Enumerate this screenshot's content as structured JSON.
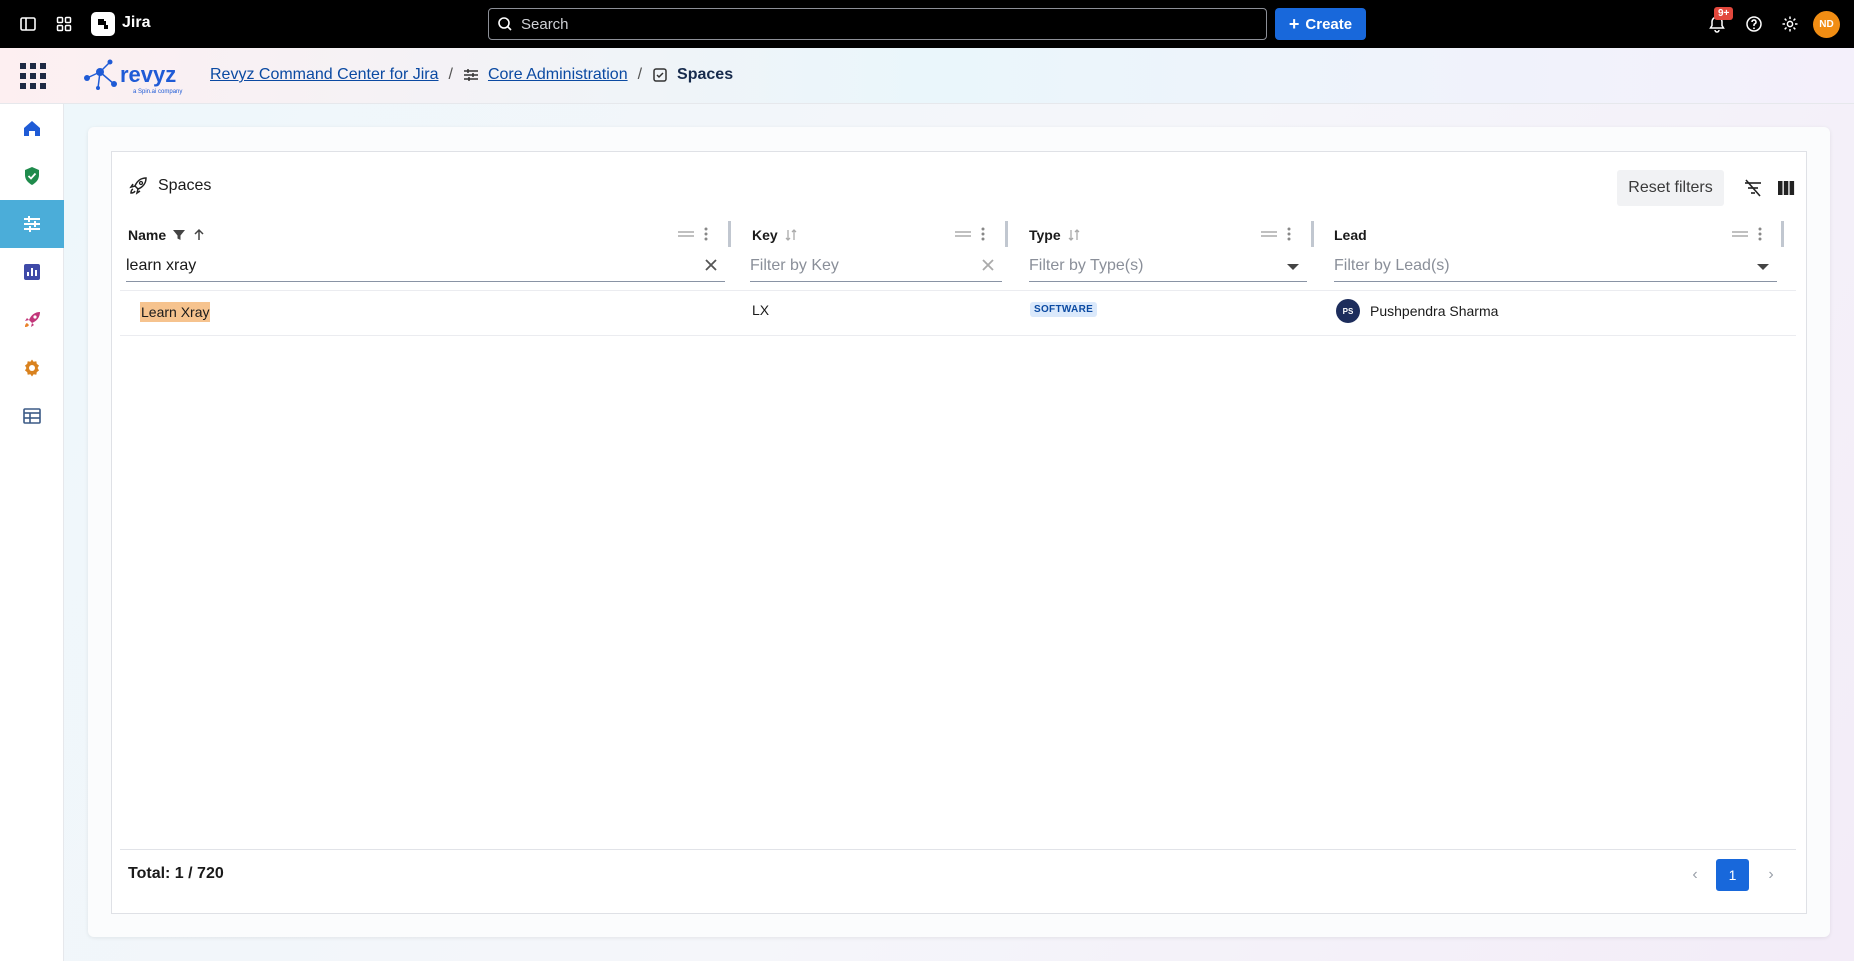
{
  "topbar": {
    "app_name": "Jira",
    "search_placeholder": "Search",
    "create_label": "Create",
    "notification_count": "9+",
    "avatar_initials": "ND"
  },
  "header": {
    "breadcrumbs": [
      {
        "label": "Revyz Command Center for Jira"
      },
      {
        "label": "Core Administration"
      },
      {
        "label": "Spaces"
      }
    ],
    "logo_text": "revyz",
    "logo_sub": "a Spin.ai company"
  },
  "sidebar": {
    "items": [
      {
        "icon": "home-icon"
      },
      {
        "icon": "shield-check-icon"
      },
      {
        "icon": "sliders-icon",
        "active": true
      },
      {
        "icon": "report-icon"
      },
      {
        "icon": "rocket-icon"
      },
      {
        "icon": "gear-icon"
      },
      {
        "icon": "table-icon"
      }
    ]
  },
  "panel": {
    "title": "Spaces",
    "reset_label": "Reset filters"
  },
  "table": {
    "columns": [
      {
        "label": "Name",
        "filter_value": "learn xray",
        "filter_placeholder": ""
      },
      {
        "label": "Key",
        "filter_value": "",
        "filter_placeholder": "Filter by Key"
      },
      {
        "label": "Type",
        "filter_value": "",
        "filter_placeholder": "Filter by Type(s)"
      },
      {
        "label": "Lead",
        "filter_value": "",
        "filter_placeholder": "Filter by Lead(s)"
      }
    ],
    "rows": [
      {
        "name": "Learn Xray",
        "key": "LX",
        "type": "SOFTWARE",
        "lead_initials": "PS",
        "lead": "Pushpendra Sharma"
      }
    ]
  },
  "footer": {
    "total": "Total: 1 / 720",
    "current_page": "1"
  },
  "colors": {
    "accent": "#1868db",
    "active_sidebar": "#4badd9",
    "highlight": "#f6c38e"
  }
}
